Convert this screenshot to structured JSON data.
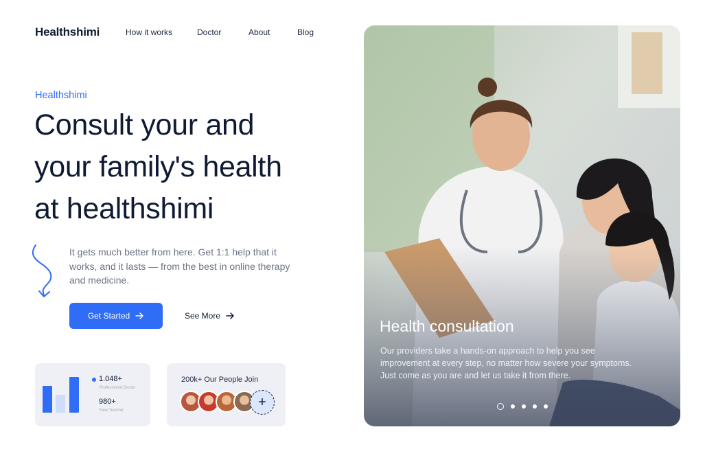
{
  "nav": {
    "logo": "Healthshimi",
    "links": [
      "How it works",
      "Doctor",
      "About",
      "Blog"
    ]
  },
  "hero": {
    "eyebrow": "Healthshimi",
    "headline_lines": [
      "Consult your and",
      "your family's health",
      "at healthshimi"
    ],
    "description": "It gets much better from here. Get 1:1 help that it works, and it lasts — from the best in online therapy and medicine.",
    "primary_button": "Get Started",
    "secondary_button": "See More"
  },
  "stats_card": {
    "stats": [
      {
        "value": "1.048+",
        "label": "Professional Doctor"
      },
      {
        "value": "980+",
        "label": "New Teacher"
      }
    ]
  },
  "join_card": {
    "title": "200k+ Our People Join",
    "add_label": "+"
  },
  "feature": {
    "title": "Health consultation",
    "description": "Our providers take a hands-on approach to help you see improvement at every step, no matter how severe your symptoms. Just come as you are and let us take it from there.",
    "slide_count": 5,
    "active_slide": 1
  },
  "colors": {
    "accent": "#2f6df6",
    "text_dark": "#0f1b33",
    "text_muted": "#6b7385",
    "card_bg": "#eef0f5"
  },
  "icons": {
    "arrow": "arrow-right-icon",
    "squiggle": "squiggle-arrow-icon",
    "add": "plus-icon"
  }
}
